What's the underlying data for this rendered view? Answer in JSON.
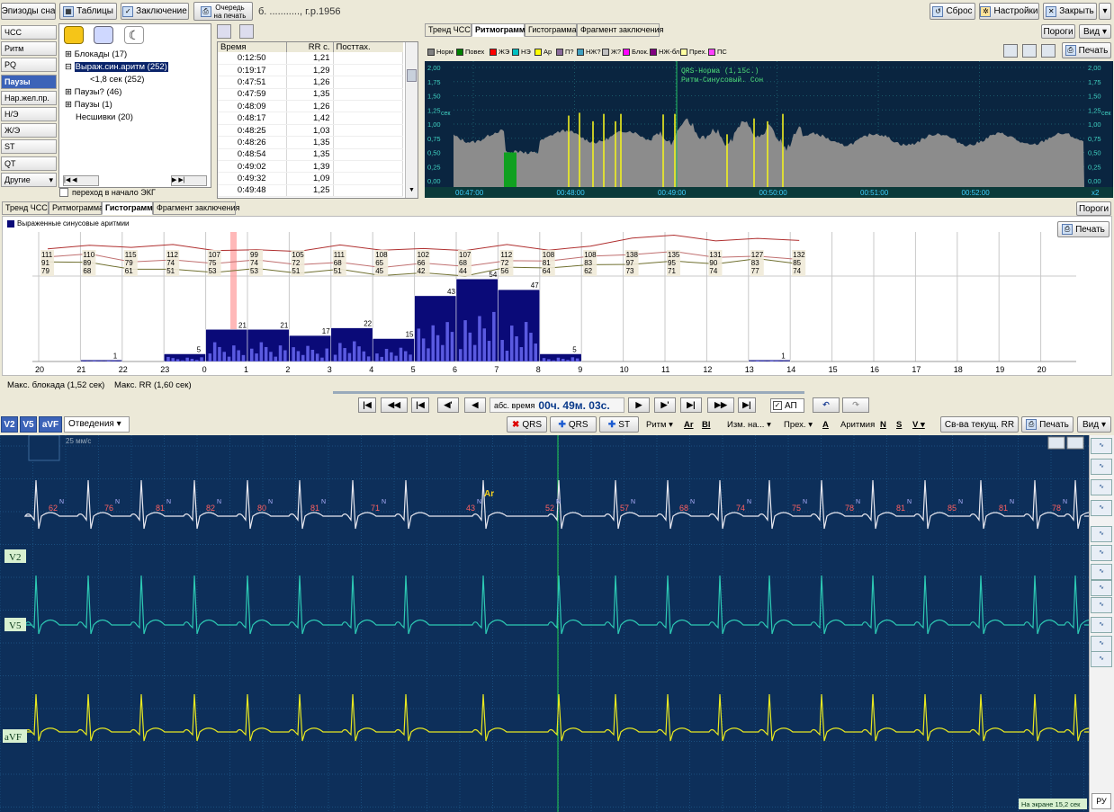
{
  "top": {
    "episodes": "Эпизоды сна",
    "tables": "Таблицы",
    "conclusion": "Заключение",
    "queue1": "Очередь",
    "queue2": "на печать",
    "patient": "б. ..........., г.р.1956",
    "reset": "Сброс",
    "settings": "Настройки",
    "close": "Закрыть"
  },
  "left_tabs": [
    "ЧСС",
    "Ритм",
    "PQ",
    "Паузы",
    "Нар.жел.пр.",
    "Н/Э",
    "Ж/Э",
    "ST",
    "QT",
    "Другие"
  ],
  "left_selected": "Паузы",
  "tree": {
    "item1": "Блокады (17)",
    "item2": "Выраж.син.аритм (252)",
    "item2a": "<1,8 сек (252)",
    "item3": "Паузы? (46)",
    "item4": "Паузы (1)",
    "item5": "Несшивки (20)",
    "checkbox": "переход в начало ЭКГ"
  },
  "table": {
    "headers": [
      "Время",
      "RR с.",
      "Посттах."
    ],
    "rows": [
      [
        "0:12:50",
        "1,21"
      ],
      [
        "0:19:17",
        "1,29"
      ],
      [
        "0:47:51",
        "1,26"
      ],
      [
        "0:47:59",
        "1,35"
      ],
      [
        "0:48:09",
        "1,26"
      ],
      [
        "0:48:17",
        "1,42"
      ],
      [
        "0:48:25",
        "1,03"
      ],
      [
        "0:48:26",
        "1,35"
      ],
      [
        "0:48:54",
        "1,35"
      ],
      [
        "0:49:02",
        "1,39"
      ],
      [
        "0:49:32",
        "1,09"
      ],
      [
        "0:49:48",
        "1,25"
      ]
    ]
  },
  "rhythm": {
    "tabs": [
      "Тренд ЧСС",
      "Ритмограмма",
      "Гистограмма",
      "Фрагмент заключения"
    ],
    "selected": "Ритмограмма",
    "thresholds": "Пороги",
    "view": "Вид",
    "print": "Печать",
    "legend": [
      {
        "label": "Норм",
        "color": "#808080"
      },
      {
        "label": "Повех",
        "color": "#008000"
      },
      {
        "label": "ЖЭ",
        "color": "#ff0000"
      },
      {
        "label": "НЭ",
        "color": "#00c0c0"
      },
      {
        "label": "Ар",
        "color": "#ffff00"
      },
      {
        "label": "П?",
        "color": "#8a6a9a"
      },
      {
        "label": "НЖ?",
        "color": "#40a0c0"
      },
      {
        "label": "Ж?",
        "color": "#c0c0c0"
      },
      {
        "label": "Блок.",
        "color": "#ff00ff"
      },
      {
        "label": "НЖ-бл",
        "color": "#800080"
      },
      {
        "label": "Прех.",
        "color": "#ffffa0"
      },
      {
        "label": "ПС",
        "color": "#ff40ff"
      }
    ],
    "yticks": [
      "2,00",
      "1,75",
      "1,50",
      "1,25",
      "1,00",
      "0,75",
      "0,50",
      "0,25",
      "0,00"
    ],
    "yunit": "сек",
    "xticks": [
      "00:47:00",
      "00:48:00",
      "00:49:00",
      "00:50:00",
      "00:51:00",
      "00:52:00"
    ],
    "marker1": "QRS-Норма (1,15с.)",
    "marker2": "Ритм-Синусовый. Сон",
    "zoom": "x2"
  },
  "hist": {
    "tabs": [
      "Тренд ЧСС",
      "Ритмограмма",
      "Гистограмма",
      "Фрагмент заключения"
    ],
    "selected": "Гистограмма",
    "thresholds": "Пороги",
    "print": "Печать",
    "legend": "Выраженные синусовые аритмии",
    "hours": [
      "20",
      "21",
      "22",
      "23",
      "0",
      "1",
      "2",
      "3",
      "4",
      "5",
      "6",
      "7",
      "8",
      "9",
      "10",
      "11",
      "12",
      "13",
      "14",
      "15",
      "16",
      "17",
      "18",
      "19",
      "20"
    ],
    "counts": [
      "",
      "1",
      "",
      "5",
      "21",
      "21",
      "17",
      "22",
      "15",
      "43",
      "54",
      "47",
      "5",
      "",
      "",
      "",
      "",
      "1",
      "",
      "",
      "",
      "",
      "",
      "",
      ""
    ],
    "hr": [
      [
        "111",
        "91",
        "79"
      ],
      [
        "110",
        "89",
        "68"
      ],
      [
        "115",
        "79",
        "61"
      ],
      [
        "112",
        "74",
        "51"
      ],
      [
        "107",
        "75",
        "53"
      ],
      [
        "99",
        "74",
        "53"
      ],
      [
        "105",
        "72",
        "51"
      ],
      [
        "111",
        "68",
        "51"
      ],
      [
        "108",
        "65",
        "45"
      ],
      [
        "102",
        "66",
        "42"
      ],
      [
        "107",
        "68",
        "44"
      ],
      [
        "112",
        "72",
        "56"
      ],
      [
        "108",
        "81",
        "64"
      ],
      [
        "108",
        "83",
        "62"
      ],
      [
        "138",
        "97",
        "73"
      ],
      [
        "135",
        "95",
        "71"
      ],
      [
        "131",
        "90",
        "74"
      ],
      [
        "127",
        "83",
        "77"
      ],
      [
        "132",
        "85",
        "74"
      ]
    ],
    "max_block": "Макс. блокада (1,52 сек)",
    "max_rr": "Макс. RR (1,60 сек)"
  },
  "nav": {
    "abs_time_label": "абс. время",
    "abs_time": "00ч. 49м. 03с.",
    "ap": "АП"
  },
  "ecg_toolbar": {
    "leads": [
      "V2",
      "V5",
      "aVF"
    ],
    "leads_label": "Отведения",
    "del_qrs": "QRS",
    "add_qrs": "QRS",
    "add_st": "ST",
    "rhythm": "Ритм",
    "ar": "Ar",
    "bl": "Bl",
    "change": "Изм. на...",
    "prev": "Прех.",
    "a": "A",
    "arrhythmia": "Аритмия",
    "n": "N",
    "s": "S",
    "v": "V",
    "props": "Св-ва текущ. RR",
    "print": "Печать",
    "view": "Вид"
  },
  "ecg": {
    "speed": "25 мм/с",
    "lead1": "V2",
    "lead2": "V5",
    "lead3": "aVF",
    "ar_label": "Ar",
    "on_screen": "На экране 15,2 сек",
    "lang": "РУ",
    "beats": [
      "62",
      "76",
      "81",
      "82",
      "80",
      "81",
      "71",
      "43",
      "52",
      "57",
      "68",
      "74",
      "75",
      "78",
      "81",
      "85",
      "81",
      "78"
    ]
  },
  "colors": {
    "ecg_bg": "#0d2f5a",
    "lead1": "#e8e8f0",
    "lead2": "#2dc9b4",
    "lead3": "#e8e820",
    "hist_bar": "#0a0a78",
    "selection": "#3c63b8"
  }
}
